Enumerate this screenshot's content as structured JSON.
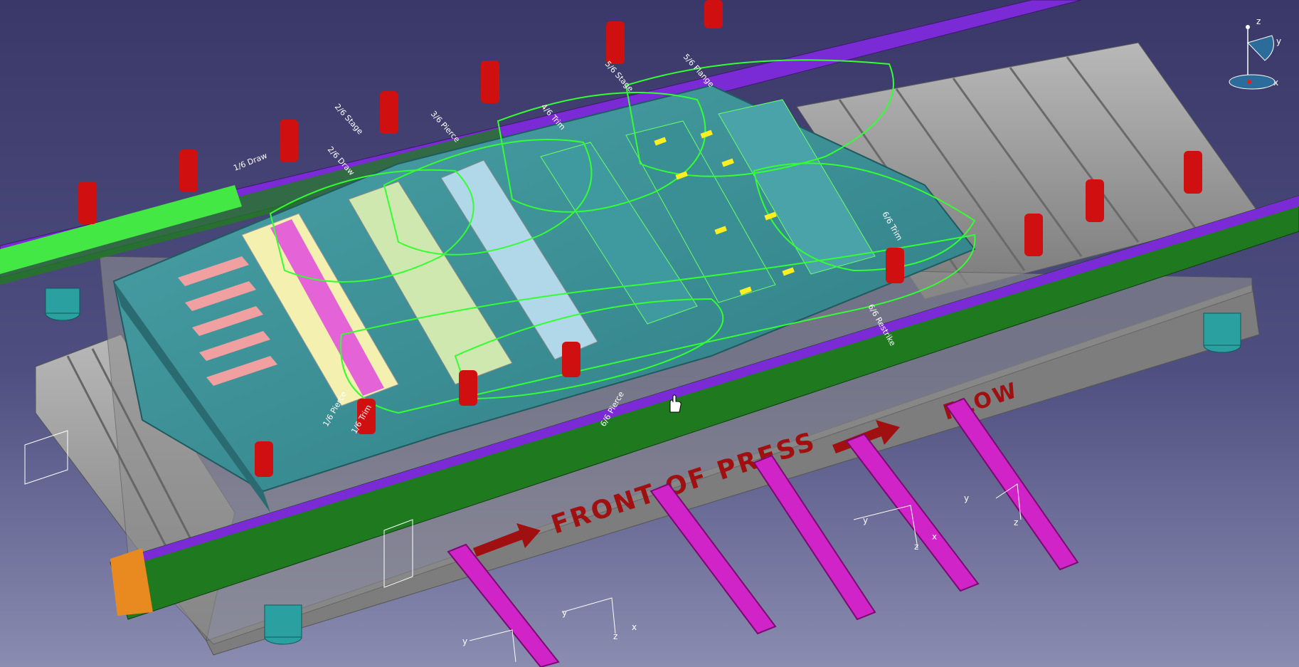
{
  "viewport": {
    "background_top": "#3a3868",
    "background_bottom": "#8a8cb0"
  },
  "press": {
    "front_text": "FRONT OF PRESS",
    "flow_text": "FLOW",
    "engrave_color": "#a01010",
    "bolster_color": "#9a9a9a",
    "rail_green": "#1f7a1f",
    "rail_purple": "#7a2bd6",
    "die_teal": "#3f8f95",
    "lifter_magenta": "#d024c8"
  },
  "die_labels": [
    "1/6 Draw",
    "1/6 Trim",
    "1/6 Pierce",
    "2/6 Stage",
    "2/6 Draw",
    "3/6 Pierce",
    "4/6 Trim",
    "5/6 Stage",
    "5/6 Flange",
    "6/6 Restrike",
    "6/6 Trim",
    "6/6 Pierce"
  ],
  "compass": {
    "axis_z": "z",
    "axis_y": "y",
    "axis_x": "x"
  },
  "triads": {
    "axis_y": "y",
    "axis_z": "z",
    "axis_x": "x"
  }
}
